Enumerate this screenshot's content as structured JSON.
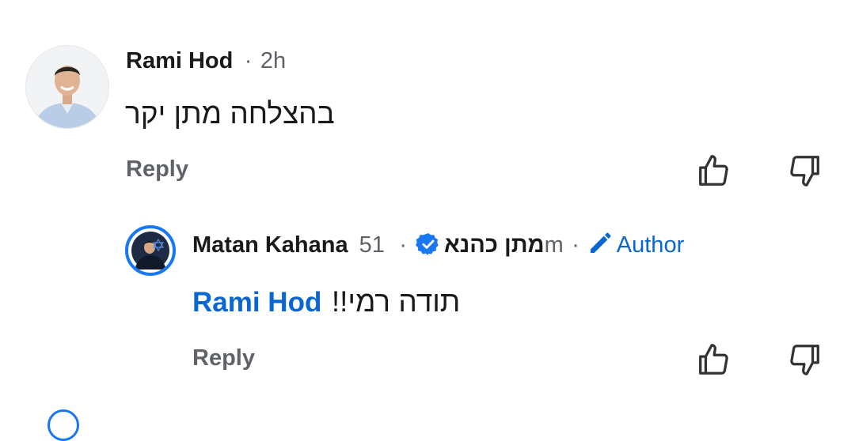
{
  "comment": {
    "author_name": "Rami Hod",
    "dot": "·",
    "time": "2h",
    "text": "בהצלחה מתן יקר",
    "reply_label": "Reply"
  },
  "reply": {
    "author_name": "Matan Kahana מתן כהנא",
    "verified_icon": "verified-badge-icon",
    "dot1": "·",
    "time": "51m",
    "dot2": "·",
    "author_badge_label": "Author",
    "mention": "Rami Hod",
    "text": "תודה רמי!!",
    "reply_label": "Reply"
  },
  "colors": {
    "link_blue": "#0a66d0",
    "meta_gray": "#5f6368",
    "text": "#1a1a1a"
  }
}
